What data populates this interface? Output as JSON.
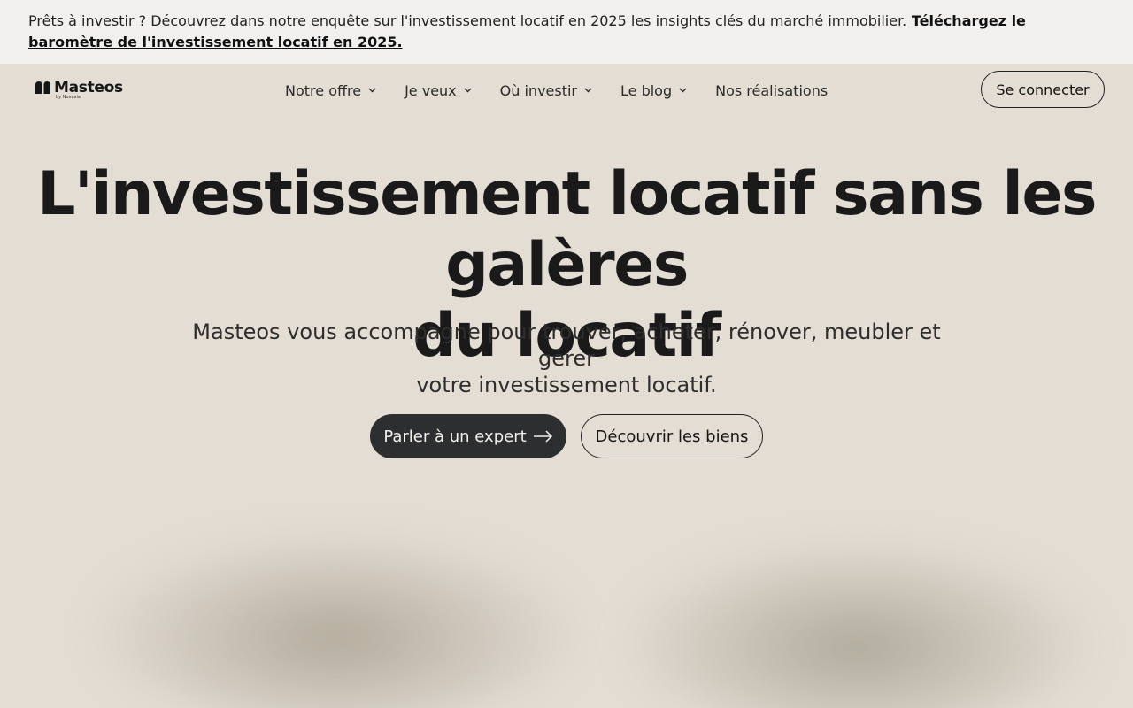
{
  "banner": {
    "text": "Prêts à investir ? Découvrez dans notre enquête sur l'investissement locatif en 2025 les insights clés du marché immobilier.",
    "link_text": " Téléchargez le baromètre de l'investissement locatif en 2025."
  },
  "logo": {
    "name": "Masteos",
    "sub": "by Novaxia"
  },
  "nav": {
    "items": [
      {
        "label": "Notre offre",
        "icon": "chevron-down-icon"
      },
      {
        "label": "Je veux",
        "icon": "chevron-down-icon"
      },
      {
        "label": "Où investir",
        "icon": "chevron-down-icon"
      },
      {
        "label": "Le blog",
        "icon": "chevron-down-icon"
      },
      {
        "label": "Nos réalisations"
      }
    ],
    "login_label": "Se connecter"
  },
  "hero": {
    "title_line1": "L'investissement locatif sans les galères",
    "title_line2": "du locatif",
    "subtitle_line1": "Masteos vous accompagne pour trouver, acheter, rénover, meubler et gérer",
    "subtitle_line2": "votre investissement locatif.",
    "primary_cta": "Parler à un expert",
    "primary_cta_icon": "arrow-right-icon",
    "secondary_cta": "Découvrir les biens"
  },
  "colors": {
    "background": "#e3ddd4",
    "banner_bg": "#f1f0ee",
    "primary_button": "#2d2e30",
    "text": "#1a1a1a"
  }
}
